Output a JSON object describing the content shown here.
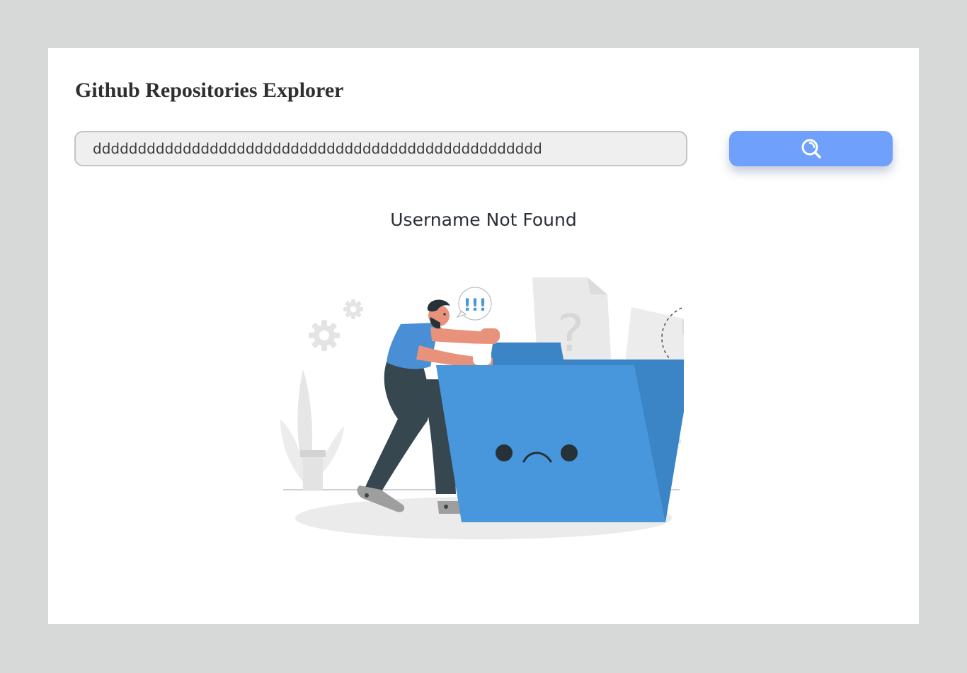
{
  "app": {
    "title": "Github Repositories Explorer"
  },
  "search": {
    "value": "dddddddddddddddddddddddddddddddddddddddddddddddddd",
    "button_icon": "search-icon"
  },
  "result": {
    "message": "Username Not Found",
    "speech_bubble_text": "!!!"
  },
  "colors": {
    "page_background": "#d7d9d9",
    "card_background": "#ffffff",
    "button": "#6fa0fb",
    "folder": "#4896db",
    "folder_dark": "#3b84c6",
    "shirt": "#4a8fd6",
    "pants": "#37474f",
    "skin": "#e8927c"
  }
}
